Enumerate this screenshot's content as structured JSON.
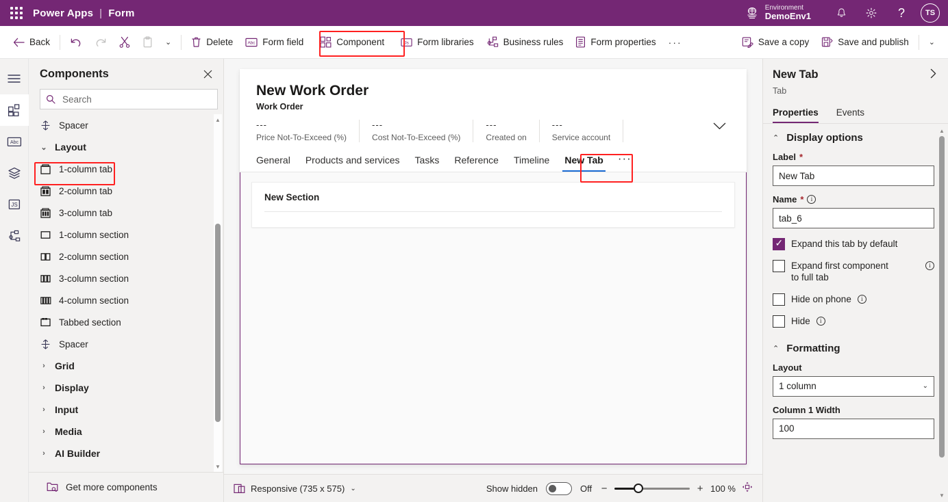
{
  "suite": {
    "brand": "Power Apps",
    "separator": "|",
    "app": "Form",
    "environment_label": "Environment",
    "environment_name": "DemoEnv1",
    "avatar_initials": "TS",
    "accent_color": "#742774"
  },
  "commandbar": {
    "back": "Back",
    "delete": "Delete",
    "form_field": "Form field",
    "component": "Component",
    "form_libraries": "Form libraries",
    "business_rules": "Business rules",
    "form_properties": "Form properties",
    "overflow": "···",
    "save_a_copy": "Save a copy",
    "save_and_publish": "Save and publish",
    "highlight_color": "#ff2020"
  },
  "components_panel": {
    "title": "Components",
    "search_placeholder": "Search",
    "search_value": "",
    "footer": "Get more components",
    "items": [
      {
        "label": "Spacer",
        "icon": "spacer-icon",
        "type": "item"
      },
      {
        "label": "Layout",
        "icon": "chevron-down-icon",
        "type": "group",
        "expanded": true
      },
      {
        "label": "1-column tab",
        "icon": "one-column-tab-icon",
        "type": "item",
        "highlighted": true
      },
      {
        "label": "2-column tab",
        "icon": "two-column-tab-icon",
        "type": "item"
      },
      {
        "label": "3-column tab",
        "icon": "three-column-tab-icon",
        "type": "item"
      },
      {
        "label": "1-column section",
        "icon": "one-column-section-icon",
        "type": "item"
      },
      {
        "label": "2-column section",
        "icon": "two-column-section-icon",
        "type": "item"
      },
      {
        "label": "3-column section",
        "icon": "three-column-section-icon",
        "type": "item"
      },
      {
        "label": "4-column section",
        "icon": "four-column-section-icon",
        "type": "item"
      },
      {
        "label": "Tabbed section",
        "icon": "tabbed-section-icon",
        "type": "item"
      },
      {
        "label": "Spacer",
        "icon": "spacer-icon",
        "type": "item"
      },
      {
        "label": "Grid",
        "icon": "chevron-right-icon",
        "type": "group",
        "expanded": false
      },
      {
        "label": "Display",
        "icon": "chevron-right-icon",
        "type": "group",
        "expanded": false
      },
      {
        "label": "Input",
        "icon": "chevron-right-icon",
        "type": "group",
        "expanded": false
      },
      {
        "label": "Media",
        "icon": "chevron-right-icon",
        "type": "group",
        "expanded": false
      },
      {
        "label": "AI Builder",
        "icon": "chevron-right-icon",
        "type": "group",
        "expanded": false
      }
    ]
  },
  "rail": {
    "items": [
      {
        "name": "menu-icon"
      },
      {
        "name": "components-icon",
        "active": true
      },
      {
        "name": "fields-icon"
      },
      {
        "name": "layers-icon"
      },
      {
        "name": "javascript-icon"
      },
      {
        "name": "business-rules-icon"
      }
    ]
  },
  "form": {
    "title": "New Work Order",
    "subtitle": "Work Order",
    "header_fields": [
      {
        "value": "---",
        "label": "Price Not-To-Exceed (%)"
      },
      {
        "value": "---",
        "label": "Cost Not-To-Exceed (%)"
      },
      {
        "value": "---",
        "label": "Created on"
      },
      {
        "value": "---",
        "label": "Service account"
      }
    ],
    "tabs": [
      {
        "label": "General",
        "selected": false
      },
      {
        "label": "Products and services",
        "selected": false
      },
      {
        "label": "Tasks",
        "selected": false
      },
      {
        "label": "Reference",
        "selected": false
      },
      {
        "label": "Timeline",
        "selected": false
      },
      {
        "label": "New Tab",
        "selected": true,
        "highlighted": true
      }
    ],
    "tabs_overflow": "···",
    "section_title": "New Section",
    "selected_tab_underline_color": "#1a6bd4",
    "tab_body_border_color": "#742774"
  },
  "statusbar": {
    "responsive_label": "Responsive (735 x 575)",
    "show_hidden_label": "Show hidden",
    "show_hidden_state": "Off",
    "zoom_minus": "−",
    "zoom_plus": "+",
    "zoom_value": "100 %",
    "zoom_percent": 100,
    "slider_position_percent": 25
  },
  "properties": {
    "title": "New Tab",
    "subtitle": "Tab",
    "tabs": [
      {
        "label": "Properties",
        "selected": true
      },
      {
        "label": "Events",
        "selected": false
      }
    ],
    "display_options": {
      "section_title": "Display options",
      "expanded": true,
      "label_field_label": "Label",
      "label_field_value": "New Tab",
      "name_field_label": "Name",
      "name_field_value": "tab_6",
      "checkboxes": [
        {
          "label": "Expand this tab by default",
          "checked": true,
          "info": false
        },
        {
          "label": "Expand first component to full tab",
          "checked": false,
          "info": true
        },
        {
          "label": "Hide on phone",
          "checked": false,
          "info": true
        },
        {
          "label": "Hide",
          "checked": false,
          "info": true
        }
      ]
    },
    "formatting": {
      "section_title": "Formatting",
      "expanded": true,
      "layout_label": "Layout",
      "layout_value": "1 column",
      "column_width_label": "Column 1 Width",
      "column_width_value": "100"
    }
  }
}
